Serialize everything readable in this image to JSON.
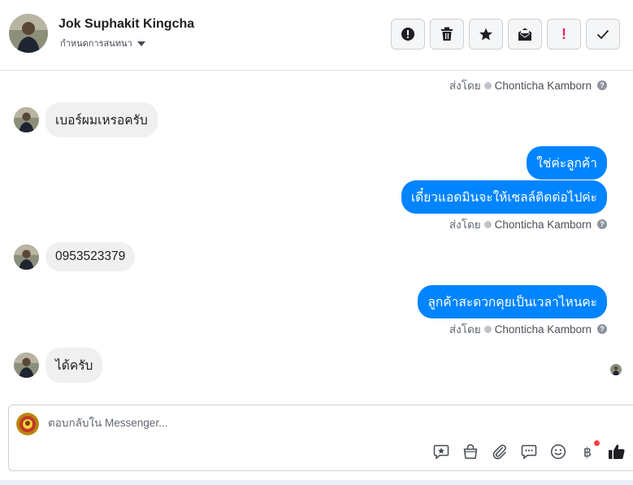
{
  "header": {
    "name": "Jok Suphakit Kingcha",
    "subtitle": "กำหนดการสนทนา"
  },
  "actions": [
    {
      "icon": "alert-circle-icon"
    },
    {
      "icon": "trash-icon"
    },
    {
      "icon": "star-icon"
    },
    {
      "icon": "mark-unread-icon"
    },
    {
      "icon": "exclamation-icon",
      "text": "!"
    },
    {
      "icon": "check-icon"
    }
  ],
  "thread": {
    "sent_by_prefix": "ส่งโดย",
    "agent_name": "Chonticha Kamborn",
    "help_glyph": "?",
    "messages": [
      {
        "dir": "in",
        "text": "เบอร์ผมเหรอครับ"
      },
      {
        "dir": "out",
        "text": "ใช่ค่ะลูกค้า"
      },
      {
        "dir": "out",
        "text": "เดี๋ยวแอดมินจะให้เซลล์ติดต่อไปค่ะ"
      },
      {
        "dir": "in",
        "text": "0953523379"
      },
      {
        "dir": "out",
        "text": "ลูกค้าสะดวกคุยเป็นเวลาไหนคะ"
      },
      {
        "dir": "in",
        "text": "ได้ครับ"
      }
    ]
  },
  "composer": {
    "placeholder": "ตอบกลับใน Messenger...",
    "tools": [
      "saved-reply-icon",
      "shop-bag-icon",
      "attachment-icon",
      "chat-bubble-icon",
      "emoji-icon",
      "baht-icon",
      "thumbs-up-icon"
    ],
    "baht_glyph": "฿"
  },
  "colors": {
    "outgoing_bubble": "#0084ff",
    "incoming_bubble": "#f0f0f0",
    "notification_dot": "#fa3e3e"
  }
}
